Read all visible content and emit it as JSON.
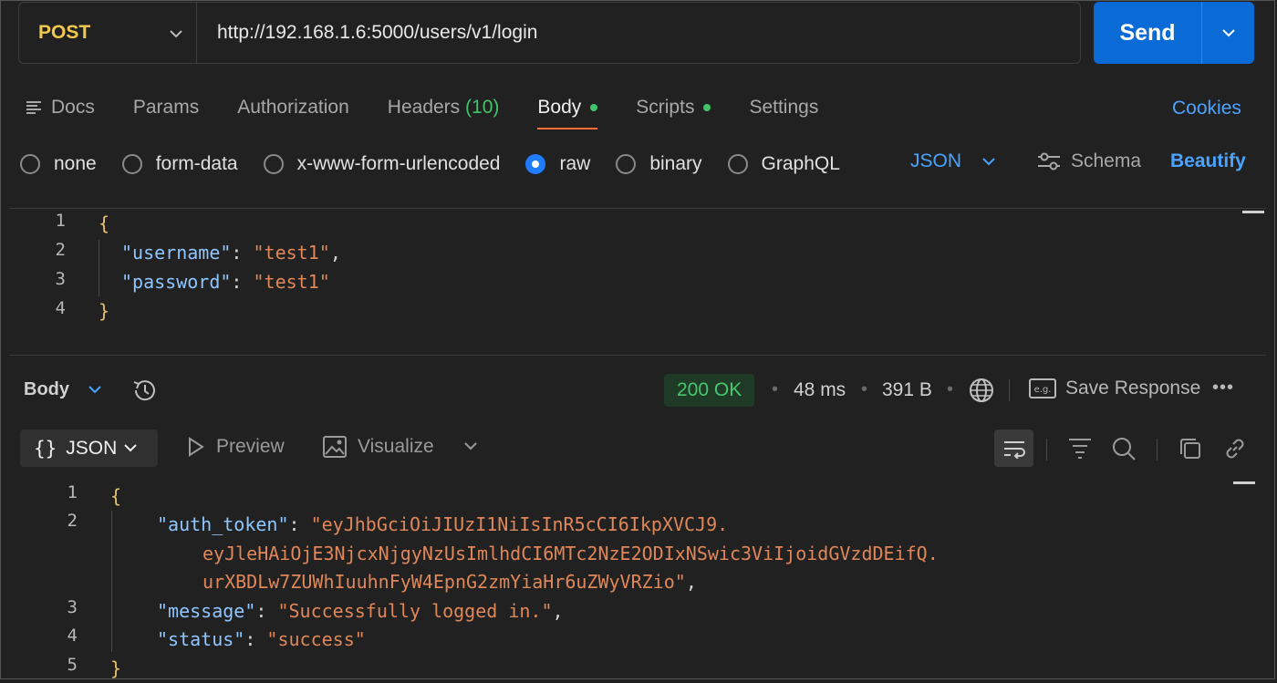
{
  "request": {
    "method": "POST",
    "url": "http://192.168.1.6:5000/users/v1/login",
    "send_label": "Send"
  },
  "tabs": [
    {
      "label": "Docs"
    },
    {
      "label": "Params"
    },
    {
      "label": "Authorization"
    },
    {
      "label": "Headers",
      "count": "(10)"
    },
    {
      "label": "Body",
      "active": true
    },
    {
      "label": "Scripts"
    },
    {
      "label": "Settings"
    }
  ],
  "cookies_label": "Cookies",
  "body_types": [
    "none",
    "form-data",
    "x-www-form-urlencoded",
    "raw",
    "binary",
    "GraphQL"
  ],
  "selected_body_type": "raw",
  "format_label": "JSON",
  "schema_label": "Schema",
  "beautify_label": "Beautify",
  "request_body": {
    "line_numbers": [
      "1",
      "2",
      "3",
      "4"
    ],
    "open_brace": "{",
    "close_brace": "}",
    "fields": [
      {
        "key": "\"username\"",
        "value": "\"test1\"",
        "trail": ","
      },
      {
        "key": "\"password\"",
        "value": "\"test1\"",
        "trail": ""
      }
    ]
  },
  "response": {
    "body_tab_label": "Body",
    "status": "200 OK",
    "time": "48 ms",
    "size": "391 B",
    "save_label": "Save Response",
    "more_label": "•••",
    "format_label": "JSON",
    "preview_label": "Preview",
    "visualize_label": "Visualize",
    "line_numbers": [
      "1",
      "2",
      "3",
      "4",
      "5"
    ],
    "open_brace": "{",
    "close_brace": "}",
    "auth_token_key": "\"auth_token\"",
    "auth_token_lines": [
      "\"eyJhbGciOiJIUzI1NiIsInR5cCI6IkpXVCJ9.",
      "eyJleHAiOjE3NjcxNjgyNzUsImlhdCI6MTc2NzE2ODIxNSwic3ViIjoidGVzdDEifQ.",
      "urXBDLw7ZUWhIuuhnFyW4EpnG2zmYiaHr6uZWyVRZio\""
    ],
    "message_key": "\"message\"",
    "message_value": "\"Successfully logged in.\"",
    "status_key": "\"status\"",
    "status_value": "\"success\""
  },
  "colors": {
    "background": "#212121",
    "accent_blue": "#0a6bd6",
    "method_yellow": "#f2c94c",
    "status_green": "#45c86c",
    "json_key": "#8fc6ff",
    "json_string": "#e0875a",
    "tab_underline": "#ff6c37"
  }
}
